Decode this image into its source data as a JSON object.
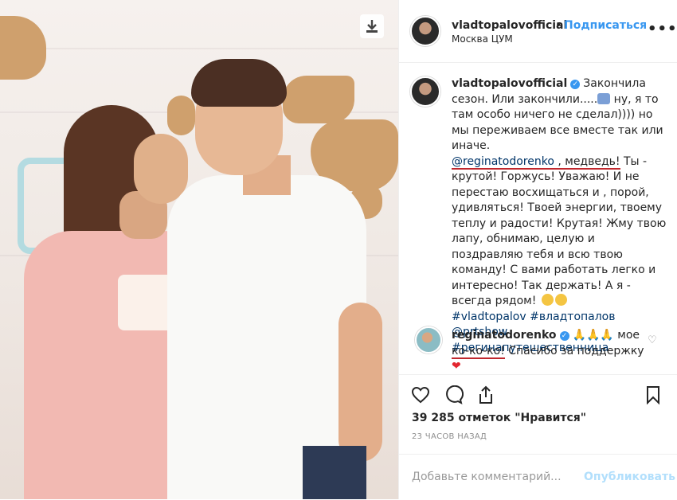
{
  "post": {
    "username": "vladtopalovofficial",
    "follow_label": "Подписаться",
    "separator": "•",
    "location": "Москва ЦУМ",
    "more_label": "•••"
  },
  "caption": {
    "username": "vladtopalovofficial",
    "verified_mark": "✓",
    "text_part1": "Закончила сезон. Или закончили.....",
    "text_part2": " ну, я то там особо ничего не сделал)))) но мы переживаем все вместе так или иначе.",
    "mention": "@reginatodorenko",
    "mention_suffix": " , медведь!",
    "text_part3": " Ты - крутой! Горжусь! Уважаю! И не перестаю восхищаться и , порой, удивляться! Твоей энергии, твоему теплу и радости! Крутая! Жму твою лапу, обнимаю, целую и поздравляю тебя и всю твою команду! С вами работать легко и интересно! Так держать! А я - всегда рядом!",
    "hashtag1": "#vladtopalov",
    "hashtag2": "#владтопалов",
    "mention2": "@prtshow",
    "hashtag3": "#регинапутешественница"
  },
  "comment": {
    "username": "reginatodorenko",
    "verified_mark": "✓",
    "hands": "🙏🙏🙏",
    "text_part1": "мое",
    "underlined": "ко-ко-ко!",
    "text_part2": " Спасибо за поддержку",
    "heart": "❤"
  },
  "actions": {
    "likes": "39 285 отметок \"Нравится\"",
    "time": "23 ЧАСОВ НАЗАД"
  },
  "add_comment": {
    "placeholder": "Добавьте комментарий...",
    "publish_label": "Опубликовать"
  },
  "colors": {
    "link_blue": "#3897f0",
    "text": "#262626",
    "muted": "#8e8e8e",
    "underline_red": "#c0272d"
  },
  "icons": [
    "download-icon",
    "more-icon",
    "verified-icon",
    "heart-icon",
    "comment-icon",
    "share-icon",
    "bookmark-icon",
    "small-heart-icon"
  ]
}
